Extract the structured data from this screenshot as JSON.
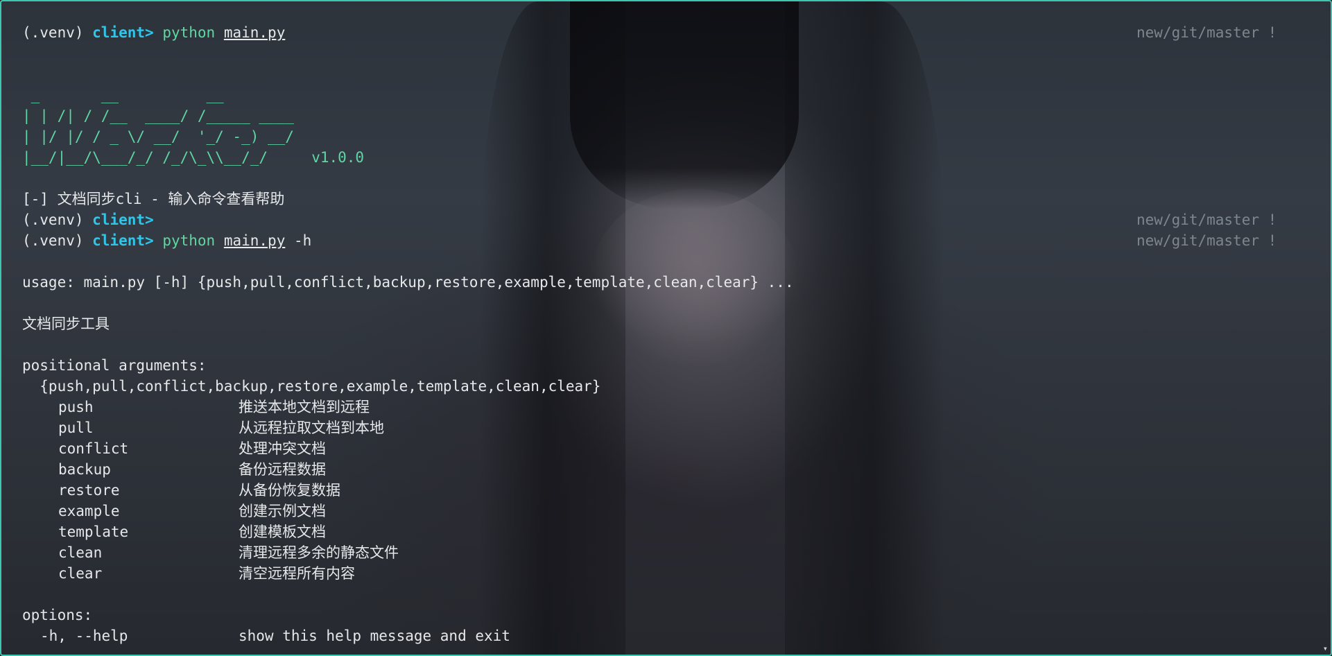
{
  "prompt": {
    "venv": "(.venv) ",
    "host": "client>",
    "git_status": "new/git/master !"
  },
  "commands": [
    {
      "program": "python",
      "script": "main.py",
      "flags": ""
    },
    {
      "program": "python",
      "script": "main.py",
      "flags": " -h"
    }
  ],
  "banner": {
    "lines": [
      " _       __          __",
      "| | /| / /__  ____/ /_____ ____",
      "| |/ |/ / _ \\/ __/  '_/ -_) __/",
      "|__/|__/\\___/_/ /_/\\_\\\\__/_/     v1.0.0"
    ]
  },
  "intro_text": "[-] 文档同步cli - 输入命令查看帮助",
  "usage": "usage: main.py [-h] {push,pull,conflict,backup,restore,example,template,clean,clear} ...",
  "description": "文档同步工具",
  "positional_header": "positional arguments:",
  "positional_choices": "  {push,pull,conflict,backup,restore,example,template,clean,clear}",
  "subcommands": [
    {
      "name": "push",
      "desc": "推送本地文档到远程"
    },
    {
      "name": "pull",
      "desc": "从远程拉取文档到本地"
    },
    {
      "name": "conflict",
      "desc": "处理冲突文档"
    },
    {
      "name": "backup",
      "desc": "备份远程数据"
    },
    {
      "name": "restore",
      "desc": "从备份恢复数据"
    },
    {
      "name": "example",
      "desc": "创建示例文档"
    },
    {
      "name": "template",
      "desc": "创建模板文档"
    },
    {
      "name": "clean",
      "desc": "清理远程多余的静态文件"
    },
    {
      "name": "clear",
      "desc": "清空远程所有内容"
    }
  ],
  "options_header": "options:",
  "options": [
    {
      "name": "-h, --help",
      "desc": "show this help message and exit"
    }
  ],
  "colors": {
    "accent_border": "#3ec7b0",
    "prompt_host": "#2fc6ea",
    "command": "#5fd7a2",
    "git_status": "#7e868d"
  }
}
